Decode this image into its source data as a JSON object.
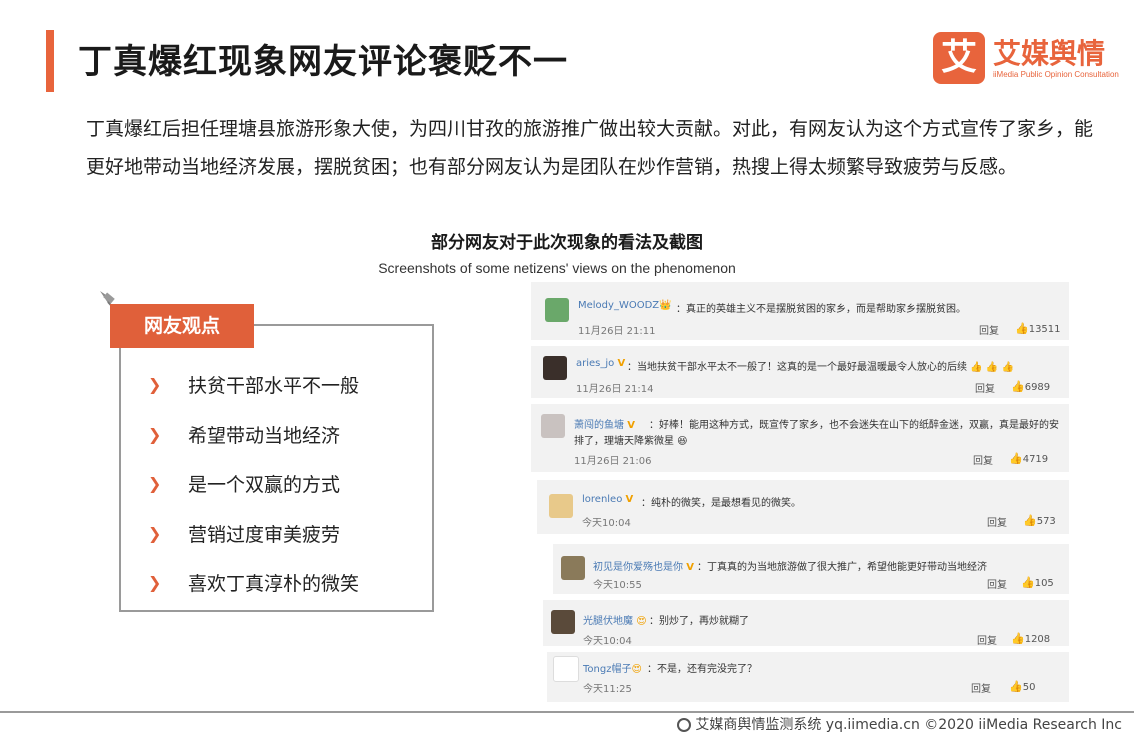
{
  "title": "丁真爆红现象网友评论褒贬不一",
  "logo": {
    "mark": "艾",
    "name": "艾媒舆情",
    "subtitle": "iiMedia Public Opinion Consultation"
  },
  "paragraph": "丁真爆红后担任理塘县旅游形象大使，为四川甘孜的旅游推广做出较大贡献。对此，有网友认为这个方式宣传了家乡，能更好地带动当地经济发展，摆脱贫困；也有部分网友认为是团队在炒作营销，热搜上得太频繁导致疲劳与反感。",
  "figure": {
    "title": "部分网友对于此次现象的看法及截图",
    "subtitle": "Screenshots of some netizens' views on the phenomenon"
  },
  "opinions": {
    "header": "网友观点",
    "items": [
      "扶贫干部水平不一般",
      "希望带动当地经济",
      "是一个双赢的方式",
      "营销过度审美疲劳",
      "喜欢丁真淳朴的微笑"
    ]
  },
  "comments": [
    {
      "user": "Melody_WOODZ",
      "text": "：真正的英雄主义不是摆脱贫困的家乡，而是帮助家乡摆脱贫困。",
      "text2": "",
      "time": "11月26日 21:11",
      "reply": "回复",
      "likes": "13511",
      "avatar_color": "#6aa86a",
      "badge": "👑"
    },
    {
      "user": "aries_jo",
      "text": "：当地扶贫干部水平太不一般了！这真的是一个最好最温暖最令人放心的后续 👍 👍 👍",
      "text2": "",
      "time": "11月26日 21:14",
      "reply": "回复",
      "likes": "6989",
      "avatar_color": "#3a2f2a",
      "badge": "V"
    },
    {
      "user": "萧闯的鱼塘",
      "text": "：好棒！能用这种方式，既宣传了家乡，也不会迷失在山下的纸醉金迷，双赢，真是最好的安",
      "text2": "排了，理塘天降紫微星 😆",
      "time": "11月26日 21:06",
      "reply": "回复",
      "likes": "4719",
      "avatar_color": "#c9c2c0",
      "badge": "V"
    },
    {
      "user": "lorenleo",
      "text": "：纯朴的微笑，是最想看见的微笑。",
      "text2": "",
      "time": "今天10:04",
      "reply": "回复",
      "likes": "573",
      "avatar_color": "#e8c98a",
      "badge": "V"
    },
    {
      "user": "初见是你爱殇也是你",
      "text": "：丁真真的为当地旅游做了很大推广，希望他能更好带动当地经济",
      "text2": "",
      "time": "今天10:55",
      "reply": "回复",
      "likes": "105",
      "avatar_color": "#8a7a5a",
      "badge": "V"
    },
    {
      "user": "光腿伏地魔",
      "text": "：别炒了，再炒就糊了",
      "text2": "",
      "time": "今天10:04",
      "reply": "回复",
      "likes": "1208",
      "avatar_color": "#5a4a3a",
      "badge": "😍"
    },
    {
      "user": "Tongz帽子",
      "text": "：不是，还有完没完了？",
      "text2": "",
      "time": "今天11:25",
      "reply": "回复",
      "likes": "50",
      "avatar_color": "#ffffff",
      "badge": "😍"
    }
  ],
  "footer": "艾媒商舆情监测系统 yq.iimedia.cn  ©2020  iiMedia Research  Inc",
  "colors": {
    "accent": "#e8643c",
    "link": "#4a7ab4"
  }
}
